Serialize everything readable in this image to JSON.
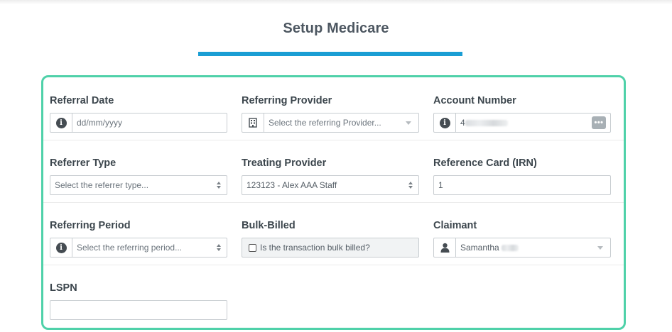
{
  "page": {
    "title": "Setup Medicare",
    "accent": "#1a9ed4",
    "card_border": "#4fd1a9"
  },
  "fields": {
    "referral_date": {
      "label": "Referral Date",
      "placeholder": "dd/mm/yyyy",
      "icon": "info-icon"
    },
    "referring_provider": {
      "label": "Referring Provider",
      "placeholder": "Select the referring Provider...",
      "icon": "building-icon"
    },
    "account_number": {
      "label": "Account Number",
      "value": "4",
      "icon": "info-icon",
      "action_icon": "more-dots-icon"
    },
    "referrer_type": {
      "label": "Referrer Type",
      "placeholder": "Select the referrer type..."
    },
    "treating_provider": {
      "label": "Treating Provider",
      "value": "123123 - Alex AAA Staff"
    },
    "reference_card": {
      "label": "Reference Card (IRN)",
      "value": "1"
    },
    "referring_period": {
      "label": "Referring Period",
      "placeholder": "Select the referring period...",
      "icon": "info-icon"
    },
    "bulk_billed": {
      "label": "Bulk-Billed",
      "checkbox_label": "Is the transaction bulk billed?",
      "checked": false
    },
    "claimant": {
      "label": "Claimant",
      "value": "Samantha",
      "icon": "user-icon"
    },
    "lspn": {
      "label": "LSPN",
      "value": ""
    }
  }
}
